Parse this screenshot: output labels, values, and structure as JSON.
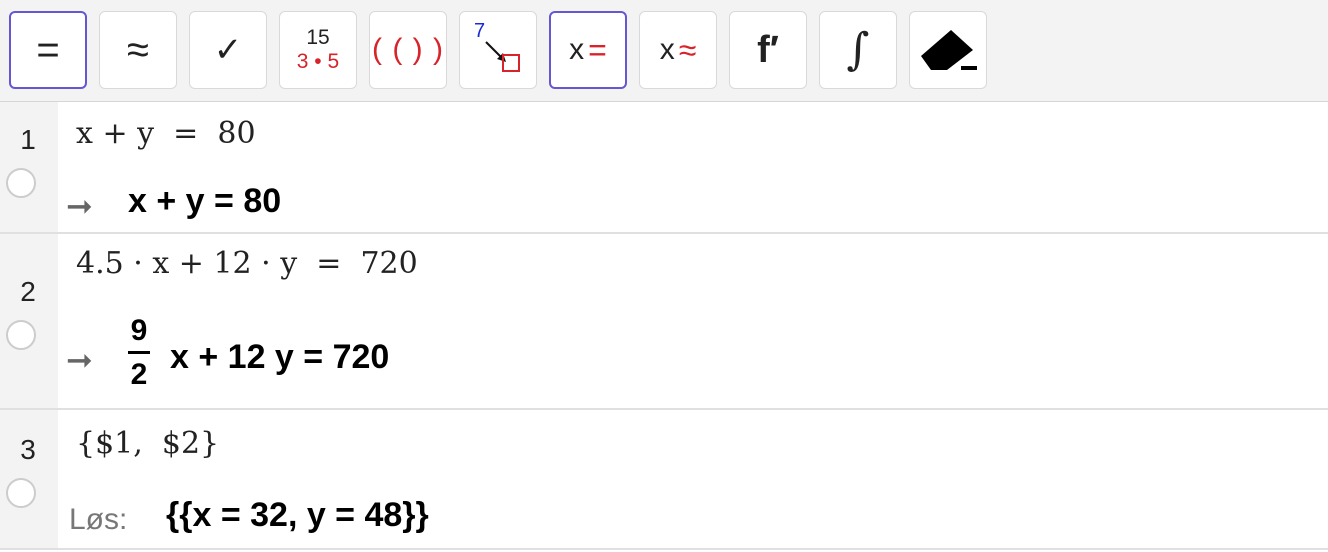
{
  "toolbar": {
    "buttons": [
      {
        "name": "evaluate-button",
        "symbol": "="
      },
      {
        "name": "numeric-button",
        "symbol": "≈"
      },
      {
        "name": "keep-input-button",
        "symbol": "✓"
      },
      {
        "name": "factor-button",
        "top": "15",
        "bottom": "3 • 5"
      },
      {
        "name": "expand-button",
        "symbol": "( ( ) )"
      },
      {
        "name": "substitute-button",
        "number": "7"
      },
      {
        "name": "solve-button",
        "x": "x",
        "symbol": "="
      },
      {
        "name": "solve-numerically-button",
        "x": "x",
        "symbol": "≈"
      },
      {
        "name": "derivative-button",
        "symbol": "f′"
      },
      {
        "name": "integral-button",
        "symbol": "∫"
      },
      {
        "name": "delete-button",
        "icon": "eraser-icon"
      }
    ],
    "active": [
      "evaluate",
      "solve"
    ],
    "accent_color": "#6557d2",
    "red_color": "#d8232a",
    "blue_color": "#1a2ad8"
  },
  "rows": [
    {
      "number": "1",
      "input": "x + y  =  80",
      "arrow": "➞",
      "output": "x + y = 80"
    },
    {
      "number": "2",
      "input": "4.5 · x + 12 · y  =  720",
      "arrow": "➞",
      "output_frac_num": "9",
      "output_frac_den": "2",
      "output": "x + 12 y = 720"
    },
    {
      "number": "3",
      "input": "{$1,  $2}",
      "label": "Løs:",
      "output": "{{x = 32, y = 48}}"
    }
  ]
}
